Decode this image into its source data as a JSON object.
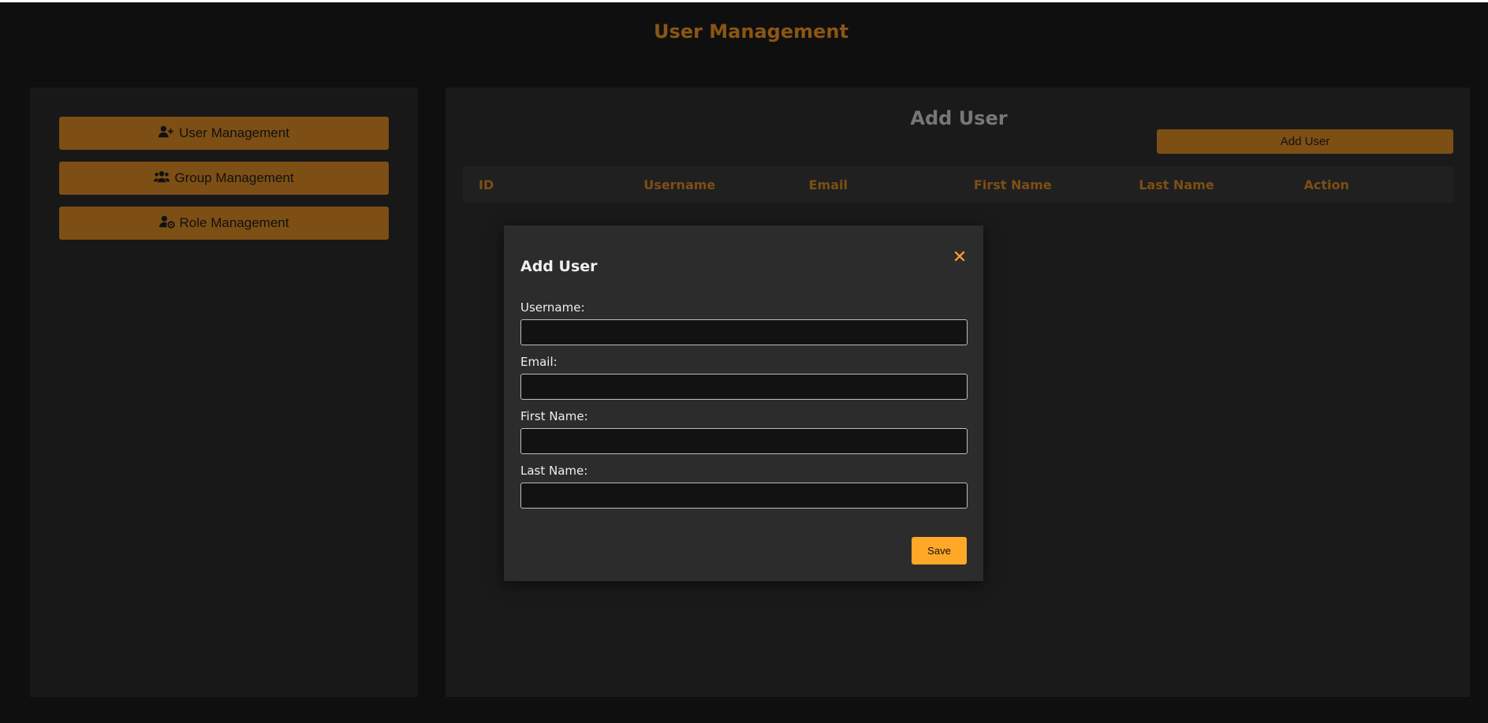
{
  "header": {
    "title": "User Management"
  },
  "sidebar": {
    "items": [
      {
        "label": "User Management",
        "icon": "user-plus-icon"
      },
      {
        "label": "Group Management",
        "icon": "users-group-icon"
      },
      {
        "label": "Role Management",
        "icon": "user-gear-icon"
      }
    ]
  },
  "main": {
    "title": "Add User",
    "add_button": "Add User",
    "table": {
      "columns": [
        "ID",
        "Username",
        "Email",
        "First Name",
        "Last Name",
        "Action"
      ],
      "rows": []
    }
  },
  "modal": {
    "title": "Add User",
    "close_icon": "close-icon",
    "fields": [
      {
        "label": "Username:",
        "value": ""
      },
      {
        "label": "Email:",
        "value": ""
      },
      {
        "label": "First Name:",
        "value": ""
      },
      {
        "label": "Last Name:",
        "value": ""
      }
    ],
    "save_label": "Save"
  },
  "colors": {
    "accent": "#7d4f14",
    "accent_bright": "#ffa726",
    "background": "#0f0f0f",
    "panel": "#1a1a1a",
    "modal": "#2c2c2c"
  }
}
